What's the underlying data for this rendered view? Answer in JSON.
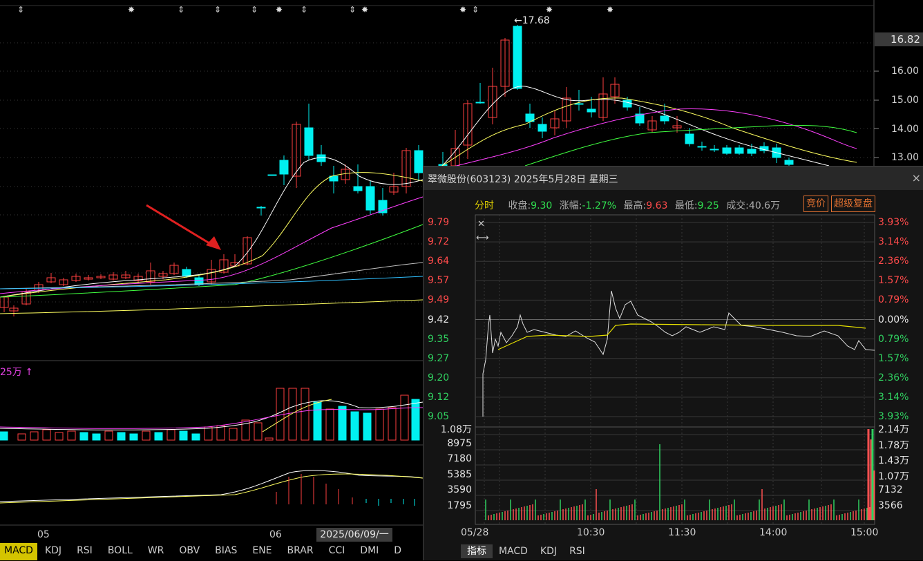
{
  "main": {
    "price_ticks": [
      "16.00",
      "15.00",
      "14.00",
      "13.00"
    ],
    "current_price": "16.82",
    "max_label": "17.68",
    "volume_label": "25万 ↑",
    "date_labels": [
      "05",
      "06"
    ],
    "cursor_date": "2025/06/09/一",
    "indicator_tabs": [
      "MACD",
      "KDJ",
      "RSI",
      "BOLL",
      "WR",
      "OBV",
      "BIAS",
      "ENE",
      "BRAR",
      "CCI",
      "DMI",
      "D"
    ],
    "colors": {
      "up": "#ff4040",
      "down": "#00f0f0",
      "ma5": "#ffffff",
      "ma10": "#ffff60",
      "ma20": "#ff40ff",
      "ma30": "#40ff40",
      "arrow": "#e02020"
    }
  },
  "popup": {
    "title": "翠微股份(603123) 2025年5月28日 星期三",
    "close_icon": "×",
    "tab_label": "分时",
    "close_label": "收盘:",
    "close_value": "9.30",
    "change_label": "涨幅:",
    "change_value": "-1.27%",
    "high_label": "最高:",
    "high_value": "9.63",
    "low_label": "最低:",
    "low_value": "9.25",
    "volume_label": "成交:",
    "volume_value": "40.6万",
    "btn_auction": "竞价",
    "btn_restore": "超级复盘",
    "price_axis": [
      {
        "price": "9.79",
        "pct": "3.93%",
        "dir": "up"
      },
      {
        "price": "9.72",
        "pct": "3.14%",
        "dir": "up"
      },
      {
        "price": "9.64",
        "pct": "2.36%",
        "dir": "up"
      },
      {
        "price": "9.57",
        "pct": "1.57%",
        "dir": "up"
      },
      {
        "price": "9.49",
        "pct": "0.79%",
        "dir": "up"
      },
      {
        "price": "9.42",
        "pct": "0.00%",
        "dir": "flat"
      },
      {
        "price": "9.35",
        "pct": "0.79%",
        "dir": "down"
      },
      {
        "price": "9.27",
        "pct": "1.57%",
        "dir": "down"
      },
      {
        "price": "9.20",
        "pct": "2.36%",
        "dir": "down"
      },
      {
        "price": "9.12",
        "pct": "3.14%",
        "dir": "down"
      },
      {
        "price": "9.05",
        "pct": "3.93%",
        "dir": "down"
      }
    ],
    "vol_left": [
      "1.08万",
      "8975",
      "7180",
      "5385",
      "3590",
      "1795"
    ],
    "vol_right": [
      "2.14万",
      "1.78万",
      "1.43万",
      "1.07万",
      "7132",
      "3566"
    ],
    "time_labels": [
      "05/28",
      "10:30",
      "11:30",
      "14:00",
      "15:00"
    ],
    "bottom_tabs": [
      "指标",
      "MACD",
      "KDJ",
      "RSI"
    ]
  }
}
